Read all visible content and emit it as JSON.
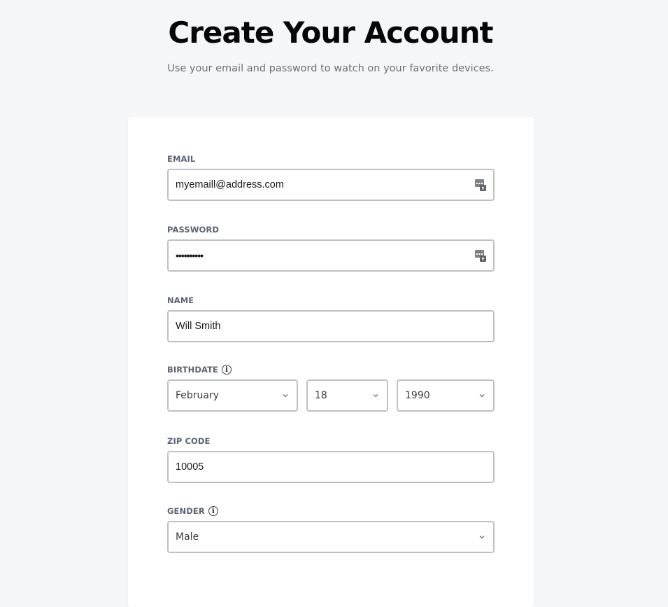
{
  "header": {
    "title": "Create Your Account",
    "subtitle": "Use your email and password to watch on your favorite devices."
  },
  "form": {
    "email": {
      "label": "EMAIL",
      "value": "myemaill@address.com",
      "icon": "password-manager-icon"
    },
    "password": {
      "label": "PASSWORD",
      "value": "••••••••••",
      "icon": "password-manager-icon"
    },
    "name": {
      "label": "NAME",
      "value": "Will Smith"
    },
    "birthdate": {
      "label": "BIRTHDATE",
      "info_icon": "i",
      "month": "February",
      "day": "18",
      "year": "1990"
    },
    "zip": {
      "label": "ZIP CODE",
      "value": "10005"
    },
    "gender": {
      "label": "GENDER",
      "info_icon": "i",
      "value": "Male"
    }
  },
  "colors": {
    "page_background": "#f5f6f8",
    "card_background": "#ffffff",
    "title": "#060607",
    "subtitle": "#6b6f75",
    "label": "#5c6470",
    "input_border": "#c0c1c3"
  }
}
